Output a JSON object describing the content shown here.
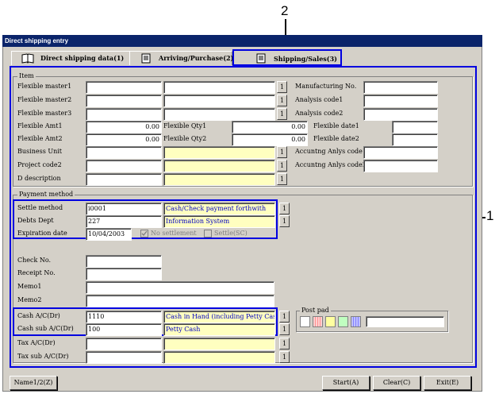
{
  "callouts": {
    "top": "2",
    "right": "1"
  },
  "window": {
    "title": "Direct shipping entry"
  },
  "tabs": [
    {
      "label": "Direct shipping data(1)"
    },
    {
      "label": "Arriving/Purchase(2)"
    },
    {
      "label": "Shipping/Sales(3)"
    }
  ],
  "item_group": {
    "title": "Item",
    "flex_master1_label": "Flexible master1",
    "flex_master2_label": "Flexible master2",
    "flex_master3_label": "Flexible master3",
    "flex_amt1_label": "Flexible Amt1",
    "flex_amt1_value": "0.00",
    "flex_amt2_label": "Flexible Amt2",
    "flex_amt2_value": "0.00",
    "flex_qty1_label": "Flexible Qty1",
    "flex_qty1_value": "0.00",
    "flex_qty2_label": "Flexible Qty2",
    "flex_qty2_value": "0.00",
    "business_unit_label": "Business Unit",
    "project_code2_label": "Project code2",
    "d_description_label": "D description",
    "manufacturing_no_label": "Manufacturing No.",
    "analysis_code1_label": "Analysis code1",
    "analysis_code2_label": "Analysis code2",
    "flex_date1_label": "Flexible date1",
    "flex_date2_label": "Flexible date2",
    "acc_anlys_code1_label": "Accuntng Anlys code1",
    "acc_anlys_code2_label": "Accuntng Anlys code2",
    "lookup_label": "1"
  },
  "payment_group": {
    "title": "Payment method",
    "settle_method_label": "Settle method",
    "settle_method_code": "i0001",
    "settle_method_name": "Cash/Check payment forthwith",
    "debts_dept_label": "Debts Dept",
    "debts_dept_code": "227",
    "debts_dept_name": "Information System",
    "expiration_date_label": "Expiration date",
    "expiration_date_value": "10/04/2003",
    "no_settlement_label": "No settlement",
    "settle_sc_label": "Settle(SC)",
    "check_no_label": "Check No.",
    "receipt_no_label": "Receipt No.",
    "memo1_label": "Memo1",
    "memo2_label": "Memo2",
    "cash_ac_label": "Cash A/C(Dr)",
    "cash_ac_code": "1110",
    "cash_ac_name": "Cash in Hand (including Petty Cash)",
    "cash_sub_ac_label": "Cash sub A/C(Dr)",
    "cash_sub_ac_code": "100",
    "cash_sub_ac_name": "Petty Cash",
    "tax_ac_label": "Tax A/C(Dr)",
    "tax_sub_ac_label": "Tax sub A/C(Dr)",
    "post_pad_label": "Post pad"
  },
  "bottom": {
    "name_button": "Name1/2(Z)",
    "start_button": "Start(A)",
    "clear_button": "Clear(C)",
    "exit_button": "Exit(E)"
  },
  "colors": {
    "highlight": "#0000e0",
    "titlebar": "#0a246a",
    "readonly_bg": "#ffffc0",
    "readonly_text": "#0000c0"
  }
}
